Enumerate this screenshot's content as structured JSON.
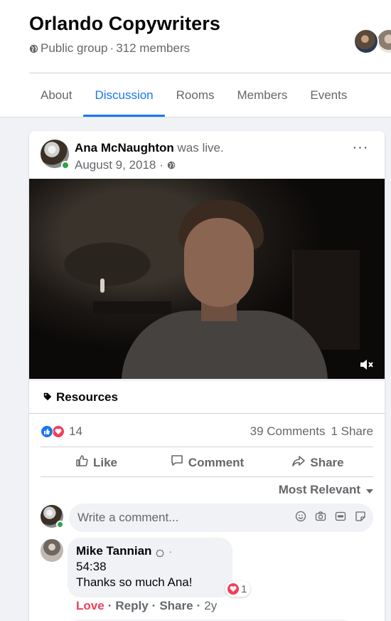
{
  "group": {
    "title": "Orlando Copywriters",
    "privacy": "Public group",
    "separator": "·",
    "members": "312 members"
  },
  "tabs": [
    {
      "label": "About",
      "active": false
    },
    {
      "label": "Discussion",
      "active": true
    },
    {
      "label": "Rooms",
      "active": false
    },
    {
      "label": "Members",
      "active": false
    },
    {
      "label": "Events",
      "active": false
    }
  ],
  "post": {
    "author": "Ana McNaughton",
    "action": " was live.",
    "date": "August 9, 2018",
    "date_sep": "·",
    "more_label": "···",
    "section_icon": "tag-icon",
    "section": "Resources",
    "reaction_count": "14",
    "comments": "39 Comments",
    "shares": "1 Share",
    "actions": {
      "like": "Like",
      "comment": "Comment",
      "share": "Share"
    },
    "sort": "Most Relevant"
  },
  "composer": {
    "placeholder": "Write a comment...",
    "icons": [
      "emoji-icon",
      "camera-icon",
      "gif-icon",
      "sticker-icon"
    ]
  },
  "comment": {
    "author": "Mike Tannian",
    "author_sep": "·",
    "line1": "54:38",
    "line2": "Thanks so much Ana!",
    "reaction_count": "1",
    "love": "Love",
    "reply": "Reply",
    "share": "Share",
    "sep": "·",
    "time": "2y"
  },
  "colors": {
    "accent": "#1877f2",
    "love": "#f33e58",
    "online": "#31a24c",
    "muted_text": "#65676b"
  }
}
